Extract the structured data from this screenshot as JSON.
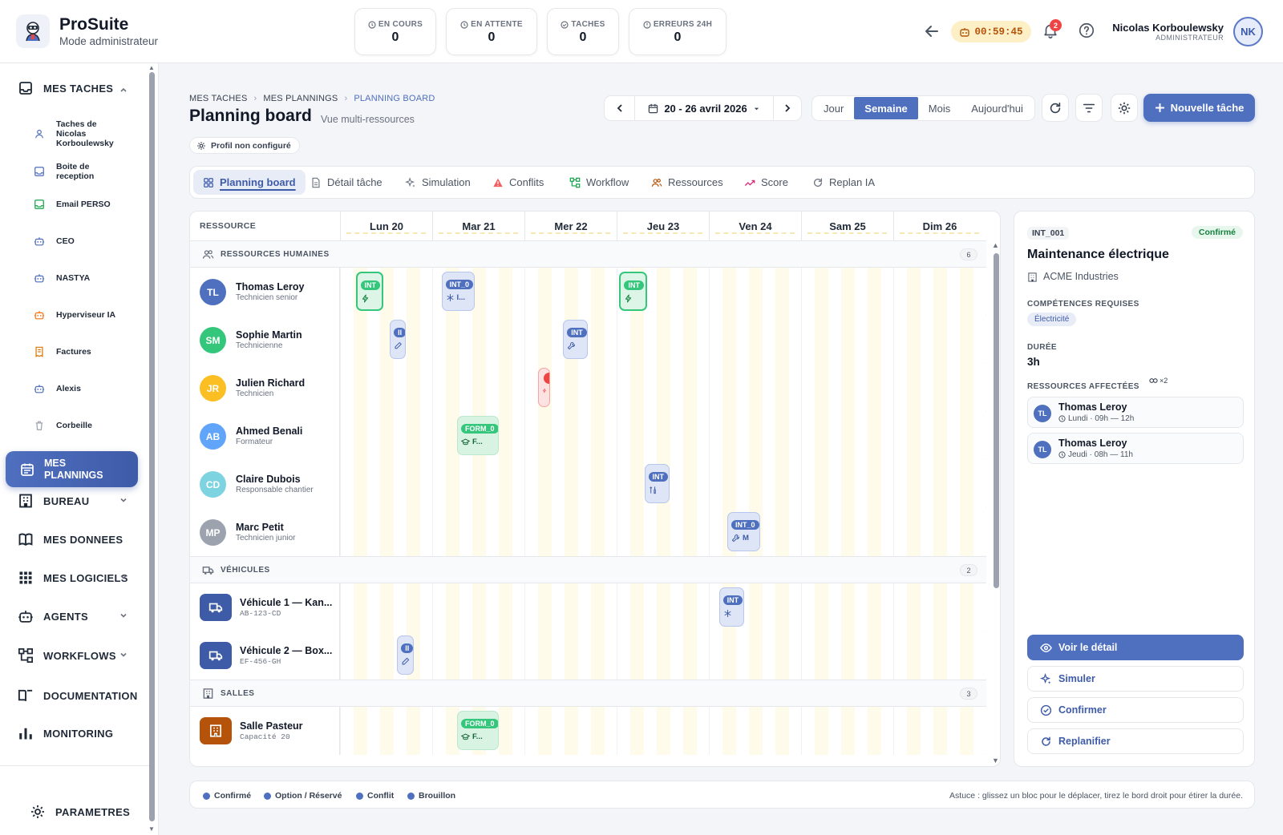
{
  "app": {
    "name": "ProSuite",
    "mode": "Mode administrateur"
  },
  "kpis": [
    {
      "label": "EN COURS",
      "value": "0"
    },
    {
      "label": "EN ATTENTE",
      "value": "0"
    },
    {
      "label": "TACHES",
      "value": "0"
    },
    {
      "label": "ERREURS 24H",
      "value": "0"
    }
  ],
  "header": {
    "timer": "00:59:45",
    "notifications": "2",
    "user_name": "Nicolas Korboulewsky",
    "user_role": "ADMINISTRATEUR",
    "user_initials": "NK"
  },
  "sidebar": {
    "mes_taches": "MES TACHES",
    "sub_items": [
      {
        "label": "Taches de Nicolas Korboulewsky",
        "icon": "user-icon",
        "color": "#4f6fbf"
      },
      {
        "label": "Boite de reception",
        "icon": "inbox-icon",
        "color": "#4f6fbf"
      },
      {
        "label": "Email PERSO",
        "icon": "inbox-icon",
        "color": "#16a34a"
      },
      {
        "label": "CEO",
        "icon": "bot-icon",
        "color": "#4f6fbf"
      },
      {
        "label": "NASTYA",
        "icon": "bot-icon",
        "color": "#4f6fbf"
      },
      {
        "label": "Hyperviseur IA",
        "icon": "bot-icon",
        "color": "#f97316"
      },
      {
        "label": "Factures",
        "icon": "receipt-icon",
        "color": "#d97706"
      },
      {
        "label": "Alexis",
        "icon": "bot-icon",
        "color": "#4f6fbf"
      },
      {
        "label": "Corbeille",
        "icon": "trash-icon",
        "color": "#9ca3af"
      }
    ],
    "active": "MES PLANNINGS",
    "main_items": [
      {
        "label": "BUREAU",
        "icon": "building-icon",
        "chevron": true
      },
      {
        "label": "MES DONNEES",
        "icon": "book-icon",
        "chevron": false
      },
      {
        "label": "MES LOGICIELS",
        "icon": "grid-icon",
        "chevron": true
      },
      {
        "label": "AGENTS",
        "icon": "bot-icon",
        "chevron": true
      },
      {
        "label": "WORKFLOWS",
        "icon": "workflow-icon",
        "chevron": true
      },
      {
        "label": "DOCUMENTATION",
        "icon": "book-open-icon",
        "chevron": false
      },
      {
        "label": "MONITORING",
        "icon": "bar-chart-icon",
        "chevron": false
      }
    ],
    "settings": "PARAMETRES"
  },
  "page": {
    "breadcrumb": [
      "MES TACHES",
      "MES PLANNINGS",
      "PLANNING BOARD"
    ],
    "title": "Planning board",
    "subtitle": "Vue multi-ressources",
    "profile_badge": "Profil non configuré",
    "date_range": "20 - 26 avril 2026",
    "views": [
      "Jour",
      "Semaine",
      "Mois",
      "Aujourd'hui"
    ],
    "active_view": "Semaine",
    "new_task": "Nouvelle tâche"
  },
  "tabs": [
    {
      "label": "Planning board",
      "icon": "board-icon",
      "active": true
    },
    {
      "label": "Détail tâche",
      "icon": "file-icon"
    },
    {
      "label": "Simulation",
      "icon": "sparkles-icon"
    },
    {
      "label": "Conflits",
      "icon": "warning-icon"
    },
    {
      "label": "Workflow",
      "icon": "workflow-icon"
    },
    {
      "label": "Ressources",
      "icon": "users-icon"
    },
    {
      "label": "Score",
      "icon": "trend-icon"
    },
    {
      "label": "Replan IA",
      "icon": "refresh-icon"
    }
  ],
  "grid": {
    "resource_header": "RESSOURCE",
    "days": [
      "Lun 20",
      "Mar 21",
      "Mer 22",
      "Jeu 23",
      "Ven 24",
      "Sam 25",
      "Dim 26"
    ],
    "sections": [
      {
        "title": "RESSOURCES HUMAINES",
        "count": "6",
        "icon": "users-icon",
        "rows": [
          {
            "initials": "TL",
            "name": "Thomas Leroy",
            "role": "Technicien senior",
            "color": "#4f6fbf"
          },
          {
            "initials": "SM",
            "name": "Sophie Martin",
            "role": "Technicienne",
            "color": "#34c77b"
          },
          {
            "initials": "JR",
            "name": "Julien Richard",
            "role": "Technicien",
            "color": "#fbbf24"
          },
          {
            "initials": "AB",
            "name": "Ahmed Benali",
            "role": "Formateur",
            "color": "#60a5fa"
          },
          {
            "initials": "CD",
            "name": "Claire Dubois",
            "role": "Responsable chantier",
            "color": "#7dd3e0"
          },
          {
            "initials": "MP",
            "name": "Marc Petit",
            "role": "Technicien junior",
            "color": "#9ca3af"
          }
        ]
      },
      {
        "title": "VÉHICULES",
        "count": "2",
        "icon": "truck-icon",
        "rows": [
          {
            "name": "Véhicule 1 — Kan...",
            "code": "AB-123-CD",
            "color": "#3e5ba8",
            "icon": "truck-icon"
          },
          {
            "name": "Véhicule 2 — Box...",
            "code": "EF-456-GH",
            "color": "#3e5ba8",
            "icon": "truck-icon"
          }
        ]
      },
      {
        "title": "SALLES",
        "count": "3",
        "icon": "building-icon",
        "rows": [
          {
            "name": "Salle Pasteur",
            "code": "Capacité 20",
            "color": "#b45309",
            "icon": "building-icon"
          }
        ]
      }
    ],
    "blocks": [
      {
        "row": 0,
        "day": 0,
        "start": 0.17,
        "span": 0.3,
        "tag": "INT",
        "info": "",
        "icon": "bolt-icon",
        "status": "confirmed-green"
      },
      {
        "row": 0,
        "day": 1,
        "start": 0.1,
        "span": 0.36,
        "tag": "INT_0",
        "info": "I...",
        "icon": "snow-icon",
        "status": "option"
      },
      {
        "row": 0,
        "day": 3,
        "start": 0.03,
        "span": 0.3,
        "tag": "INT",
        "info": "",
        "icon": "bolt-icon",
        "status": "confirmed-green"
      },
      {
        "row": 1,
        "day": 0,
        "start": 0.54,
        "span": 0.17,
        "tag": "II",
        "info": "",
        "icon": "pen-icon",
        "status": "option"
      },
      {
        "row": 1,
        "day": 2,
        "start": 0.42,
        "span": 0.27,
        "tag": "INT",
        "info": "",
        "icon": "wrench-icon",
        "status": "option"
      },
      {
        "row": 2,
        "day": 2,
        "start": 0.15,
        "span": 0.13,
        "tag": "",
        "info": "",
        "icon": "bolt-icon",
        "status": "conflict"
      },
      {
        "row": 3,
        "day": 1,
        "start": 0.27,
        "span": 0.45,
        "tag": "FORM_0",
        "info": "F...",
        "icon": "cap-icon",
        "status": "confirmed-light"
      },
      {
        "row": 4,
        "day": 3,
        "start": 0.3,
        "span": 0.27,
        "tag": "INT",
        "info": "",
        "icon": "tool-icon",
        "status": "option"
      },
      {
        "row": 5,
        "day": 4,
        "start": 0.2,
        "span": 0.36,
        "tag": "INT_0",
        "info": "M",
        "icon": "wrench-icon",
        "status": "option"
      },
      {
        "row": 6,
        "day": 4,
        "start": 0.11,
        "span": 0.27,
        "tag": "INT",
        "info": "",
        "icon": "snow-icon",
        "status": "option"
      },
      {
        "row": 7,
        "day": 0,
        "start": 0.62,
        "span": 0.18,
        "tag": "II",
        "info": "",
        "icon": "pen-icon",
        "status": "option"
      },
      {
        "row": 8,
        "day": 1,
        "start": 0.27,
        "span": 0.45,
        "tag": "FORM_0",
        "info": "F...",
        "icon": "cap-icon",
        "status": "confirmed-light"
      }
    ]
  },
  "detail": {
    "id": "INT_001",
    "status": "Confirmé",
    "title": "Maintenance électrique",
    "client": "ACME Industries",
    "skills_label": "COMPÉTENCES REQUISES",
    "skill": "Électricité",
    "duration_label": "DURÉE",
    "duration": "3h",
    "resources_label": "RESSOURCES AFFECTÉES",
    "resources_multiplier": "×2",
    "assignments": [
      {
        "initials": "TL",
        "name": "Thomas Leroy",
        "time": "Lundi · 09h — 12h"
      },
      {
        "initials": "TL",
        "name": "Thomas Leroy",
        "time": "Jeudi · 08h — 11h"
      }
    ],
    "actions": [
      "Voir le détail",
      "Simuler",
      "Confirmer",
      "Replanifier"
    ]
  },
  "legend": {
    "items": [
      "Confirmé",
      "Option / Réservé",
      "Conflit",
      "Brouillon"
    ],
    "tip": "Astuce : glissez un bloc pour le déplacer, tirez le bord droit pour étirer la durée."
  },
  "colors": {
    "accent": "#4f6fbf",
    "confirmed": "#34c77b",
    "conflict": "#ef4444",
    "weekend": "#fffbea"
  }
}
